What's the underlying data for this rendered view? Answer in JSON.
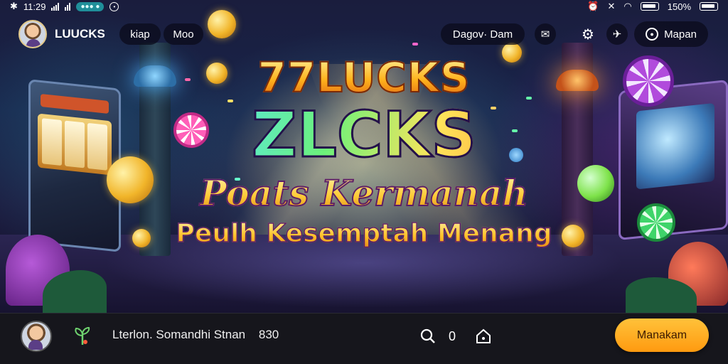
{
  "status_bar": {
    "time": "11:29",
    "network_badge": "●●● ●",
    "battery_percent": "150%"
  },
  "header": {
    "brand": "LUUCKS",
    "nav_items": [
      "kiap",
      "Moo"
    ],
    "right_chip": "Dagov· Dam",
    "account_label": "Mapan"
  },
  "banner": {
    "line1": "77LUCKS",
    "line2": "ZLCKS",
    "line3": "Poats Kermanah",
    "line4": "Peulh Kesemptah Menang"
  },
  "footer": {
    "ticker_text": "Lterlon. Somandhi Stnan",
    "ticker_number": "830",
    "counter": "0",
    "cta_label": "Manakam"
  },
  "colors": {
    "cta": "#ff9a10",
    "title_gold": "#ffb21c",
    "footer_bg": "#16161c"
  },
  "icons": {
    "status": [
      "bluetooth-icon",
      "signal-icon",
      "alarm-icon",
      "mute-icon",
      "wifi-icon",
      "battery-icon"
    ],
    "header": [
      "message-icon",
      "settings-icon",
      "chat-icon",
      "user-icon"
    ],
    "footer": [
      "sprout-icon",
      "search-icon",
      "home-icon"
    ]
  }
}
